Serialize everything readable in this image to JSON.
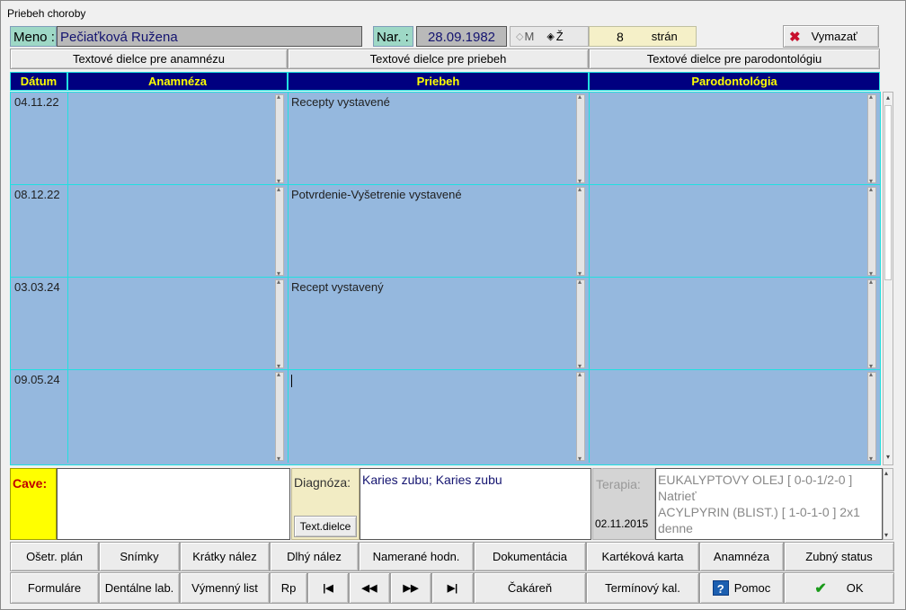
{
  "window": {
    "title": "Priebeh choroby"
  },
  "patient": {
    "name_label": "Meno :",
    "name_value": "Pečiaťková Ružena",
    "birth_label": "Nar. :",
    "birth_value": "28.09.1982",
    "gender_m": "M",
    "gender_z": "Ž",
    "pages_count": "8",
    "pages_label": "strán",
    "delete_label": "Vymazať"
  },
  "text_parts": {
    "anamnesis": "Textové dielce pre anamnézu",
    "course": "Textové dielce pre priebeh",
    "periodontology": "Textové dielce pre parodontológiu"
  },
  "table": {
    "headers": {
      "date": "Dátum",
      "anamnesis": "Anamnéza",
      "course": "Priebeh",
      "periodontology": "Parodontológia"
    },
    "rows": [
      {
        "date": "04.11.22",
        "anamnesis": "",
        "course": "Recepty vystavené",
        "periodontology": ""
      },
      {
        "date": "08.12.22",
        "anamnesis": "",
        "course": "Potvrdenie-Vyšetrenie vystavené",
        "periodontology": ""
      },
      {
        "date": "03.03.24",
        "anamnesis": "",
        "course": "Recept vystavený",
        "periodontology": ""
      },
      {
        "date": "09.05.24",
        "anamnesis": "",
        "course": "",
        "periodontology": ""
      }
    ]
  },
  "bottom": {
    "cave_label": "Cave:",
    "cave_value": "",
    "diagnosis_label": "Diagnóza:",
    "diagnosis_value": "Karies zubu; Karies zubu",
    "text_parts_button": "Text.dielce",
    "therapy_label": "Terapia:",
    "therapy_date": "02.11.2015",
    "therapy_lines": [
      "EUKALYPTOVY OLEJ [ 0-0-1/2-0 ]",
      "Natrieť",
      "ACYLPYRIN (BLIST.) [ 1-0-1-0 ] 2x1",
      "denne"
    ]
  },
  "toolbar_row1": [
    "Ošetr. plán",
    "Snímky",
    "Krátky nález",
    "Dlhý nález",
    "Namerané hodn.",
    "Dokumentácia",
    "Kartéková karta",
    "Anamnéza",
    "Zubný status"
  ],
  "toolbar_row2": {
    "forms": "Formuláre",
    "dental_lab": "Dentálne lab.",
    "exchange_list": "Výmenný list",
    "rp": "Rp",
    "waiting_room": "Čakáreň",
    "calendar": "Termínový kal.",
    "help": "Pomoc",
    "ok": "OK"
  },
  "colors": {
    "accent_header": "#000080",
    "header_text": "#ffff00",
    "grid_bg": "#95b8de",
    "grid_lines": "#20e0e0",
    "cave_bg": "#ffff00"
  }
}
